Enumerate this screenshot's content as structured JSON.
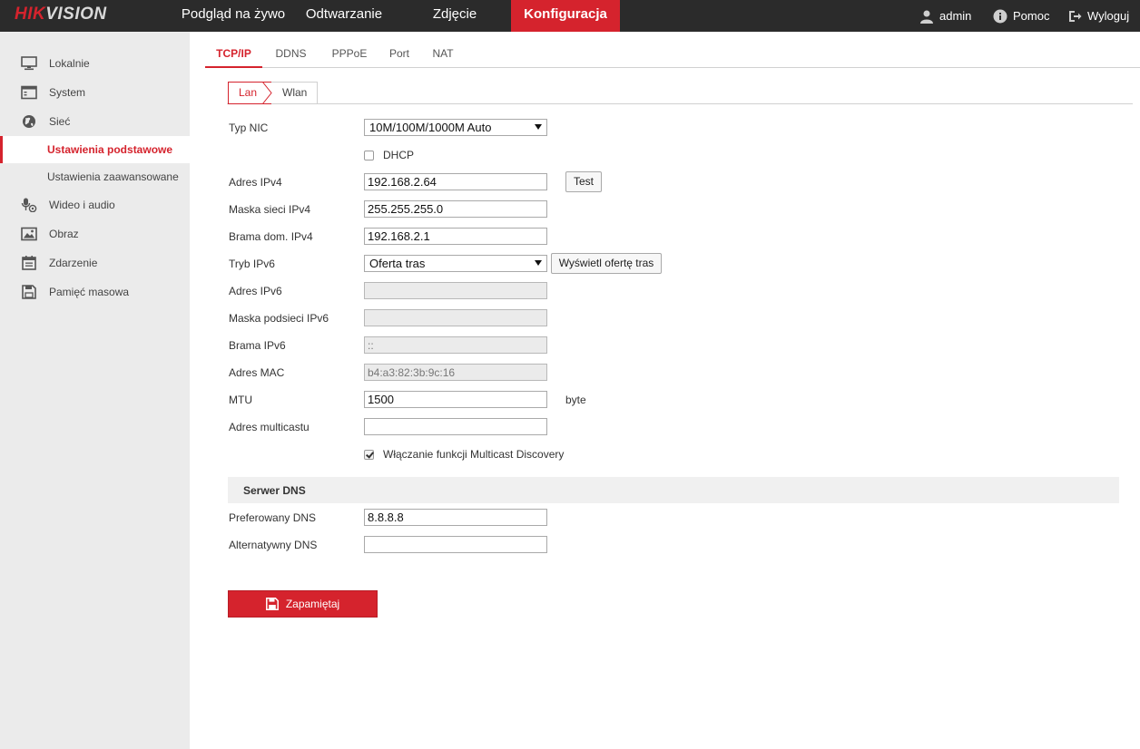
{
  "header": {
    "logo_red": "HIK",
    "logo_white": "VISION",
    "nav": [
      "Podgląd na żywo",
      "Odtwarzanie",
      "Zdjęcie",
      "Konfiguracja"
    ],
    "user": "admin",
    "help": "Pomoc",
    "logout": "Wyloguj"
  },
  "sidebar": {
    "items": {
      "local": "Lokalnie",
      "system": "System",
      "network": "Sieć",
      "basic": "Ustawienia podstawowe",
      "advanced": "Ustawienia zaawansowane",
      "video": "Wideo i audio",
      "image": "Obraz",
      "event": "Zdarzenie",
      "storage": "Pamięć masowa"
    }
  },
  "tabs": [
    "TCP/IP",
    "DDNS",
    "PPPoE",
    "Port",
    "NAT"
  ],
  "subtabs": [
    "Lan",
    "Wlan"
  ],
  "form": {
    "nic_type_label": "Typ NIC",
    "nic_type_value": "10M/100M/1000M Auto",
    "dhcp_label": "DHCP",
    "ipv4_label": "Adres IPv4",
    "ipv4_value": "192.168.2.64",
    "test_button": "Test",
    "mask_label": "Maska sieci IPv4",
    "mask_value": "255.255.255.0",
    "gateway_label": "Brama dom. IPv4",
    "gateway_value": "192.168.2.1",
    "ipv6_mode_label": "Tryb IPv6",
    "ipv6_mode_value": "Oferta tras",
    "show_routes_button": "Wyświetl ofertę tras",
    "ipv6_addr_label": "Adres IPv6",
    "ipv6_addr_value": "",
    "ipv6_mask_label": "Maska podsieci IPv6",
    "ipv6_mask_value": "",
    "ipv6_gw_label": "Brama IPv6",
    "ipv6_gw_value": "::",
    "mac_label": "Adres MAC",
    "mac_value": "b4:a3:82:3b:9c:16",
    "mtu_label": "MTU",
    "mtu_value": "1500",
    "mtu_unit": "byte",
    "multicast_label": "Adres multicastu",
    "multicast_value": "",
    "multicast_discovery_label": "Włączanie funkcji Multicast Discovery",
    "dns_section": "Serwer DNS",
    "pref_dns_label": "Preferowany DNS",
    "pref_dns_value": "8.8.8.8",
    "alt_dns_label": "Alternatywny DNS",
    "alt_dns_value": "",
    "save_button": "Zapamiętaj"
  },
  "colors": {
    "accent": "#d5232d",
    "topbar": "#2b2b2b",
    "sidebar": "#ebebeb"
  }
}
